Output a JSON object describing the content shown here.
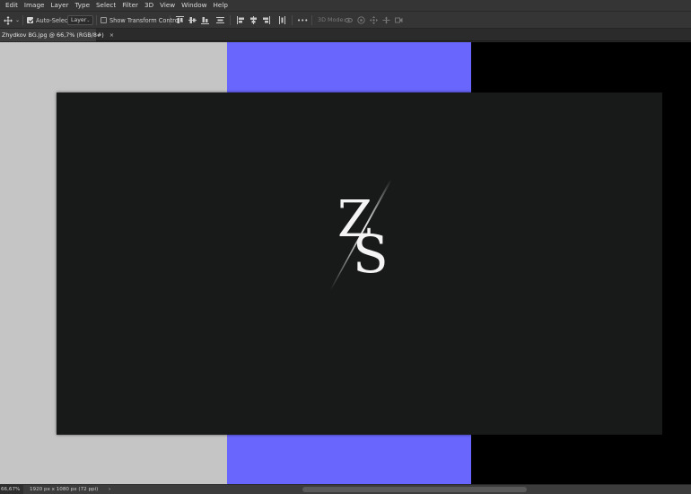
{
  "menubar": {
    "items": [
      {
        "label": "Edit"
      },
      {
        "label": "Image"
      },
      {
        "label": "Layer"
      },
      {
        "label": "Type"
      },
      {
        "label": "Select"
      },
      {
        "label": "Filter"
      },
      {
        "label": "3D"
      },
      {
        "label": "View"
      },
      {
        "label": "Window"
      },
      {
        "label": "Help"
      }
    ]
  },
  "options": {
    "tool_icon": "move-tool-icon",
    "auto_select_label": "Auto-Select:",
    "auto_select_checked": true,
    "auto_select_target": "Layer",
    "show_transform_label": "Show Transform Controls",
    "show_transform_checked": false,
    "more_label": "•••",
    "mode_3d_label": "3D Mode:"
  },
  "tab": {
    "title": "Zhydkov BG.jpg @ 66,7% (RGB/8#)",
    "close": "×"
  },
  "canvas": {
    "logo_top_letter": "Z",
    "logo_bottom_letter": "S"
  },
  "colors": {
    "band_gray": "#c5c5c5",
    "band_blue": "#6966fe",
    "band_black": "#000000",
    "document_bg": "#181919",
    "logo_white": "#f4f4f4"
  },
  "status": {
    "zoom": "66,67%",
    "doc_size": "1920 px x 1080 px (72 ppi)",
    "arrow": "›"
  }
}
